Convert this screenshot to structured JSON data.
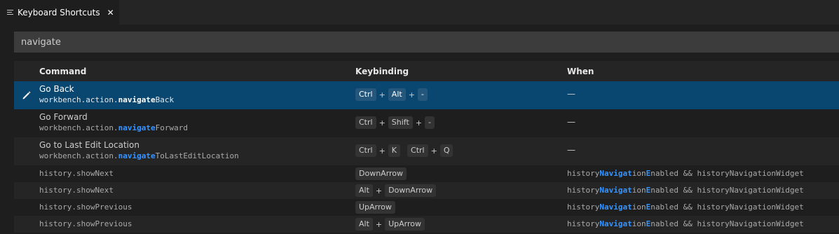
{
  "tab": {
    "title": "Keyboard Shortcuts",
    "close": "✕"
  },
  "search": {
    "value": "navigate"
  },
  "headers": {
    "command": "Command",
    "keybinding": "Keybinding",
    "when": "When"
  },
  "rows": [
    {
      "title": "Go Back",
      "id_pre": "workbench.action.",
      "id_hl": "navigate",
      "id_post": "Back",
      "keys": [
        "Ctrl",
        "Alt",
        "-"
      ],
      "when": "—"
    },
    {
      "title": "Go Forward",
      "id_pre": "workbench.action.",
      "id_hl": "navigate",
      "id_post": "Forward",
      "keys": [
        "Ctrl",
        "Shift",
        "-"
      ],
      "when": "—"
    },
    {
      "title": "Go to Last Edit Location",
      "id_pre": "workbench.action.",
      "id_hl": "navigate",
      "id_post": "ToLastEditLocation",
      "chord1": [
        "Ctrl",
        "K"
      ],
      "chord2": [
        "Ctrl",
        "Q"
      ],
      "when": "—"
    },
    {
      "id": "history.showNext",
      "keys": [
        "DownArrow"
      ]
    },
    {
      "id": "history.showNext",
      "keys": [
        "Alt",
        "DownArrow"
      ]
    },
    {
      "id": "history.showPrevious",
      "keys": [
        "UpArrow"
      ]
    },
    {
      "id": "history.showPrevious",
      "keys": [
        "Alt",
        "UpArrow"
      ]
    }
  ],
  "when_parts": {
    "p1": "history",
    "h1": "Navigat",
    "p2": "ion",
    "h2": "E",
    "p3": "nabled && historyNavigationWidget"
  },
  "plus": "+",
  "colors": {
    "selection": "#094771",
    "highlight": "#3794ff"
  }
}
